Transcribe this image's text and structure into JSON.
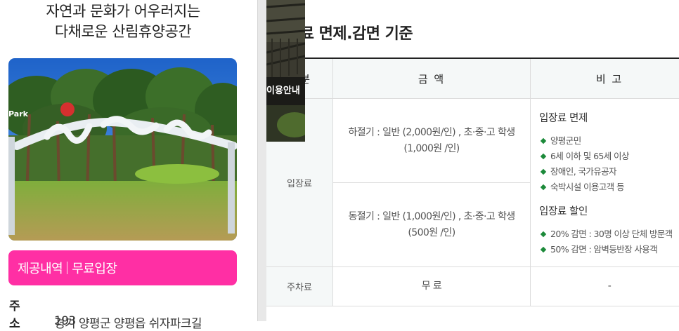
{
  "left": {
    "tagline_line1": "자연과 문화가 어우러지는",
    "tagline_line2": "다채로운 산림휴양공간",
    "sign_text": "Park",
    "provide_label": "제공내역",
    "provide_value": "무료입장",
    "address_label": "주 소",
    "address_line1": "경기 양평군 양평읍 쉬자파크길",
    "address_line2": "193"
  },
  "overlay": {
    "label": "이용안내"
  },
  "right": {
    "section_title": "용료 면제.감면 기준",
    "table": {
      "col_first": "분",
      "col_amount": "금 액",
      "col_note": "비 고",
      "row_fee_label": "입장료",
      "fee_peak": "하절기 : 일반 (2,000원/인) , 초·중·고 학생 (1,000원 /인)",
      "fee_off": "동절기 : 일반 (1,000원/인) , 초·중·고 학생 (500원 /인)",
      "exempt_title": "입장료 면제",
      "exempt_items": [
        "양평군민",
        "6세 이하 및 65세 이상",
        "장애인, 국가유공자",
        "숙박시설 이용고객 등"
      ],
      "discount_title": "입장료 할인",
      "discount_items": [
        "20% 감면 : 30명 이상 단체 방문객",
        "50% 감면 : 암벽등반장 사용객"
      ],
      "row_parking_label": "주차료",
      "parking_amount": "무 료",
      "parking_note": "-"
    }
  },
  "colors": {
    "accent_pink": "#ff2fa4",
    "bullet_green": "#1c8a3a",
    "header_bg": "#f5f8f8"
  }
}
